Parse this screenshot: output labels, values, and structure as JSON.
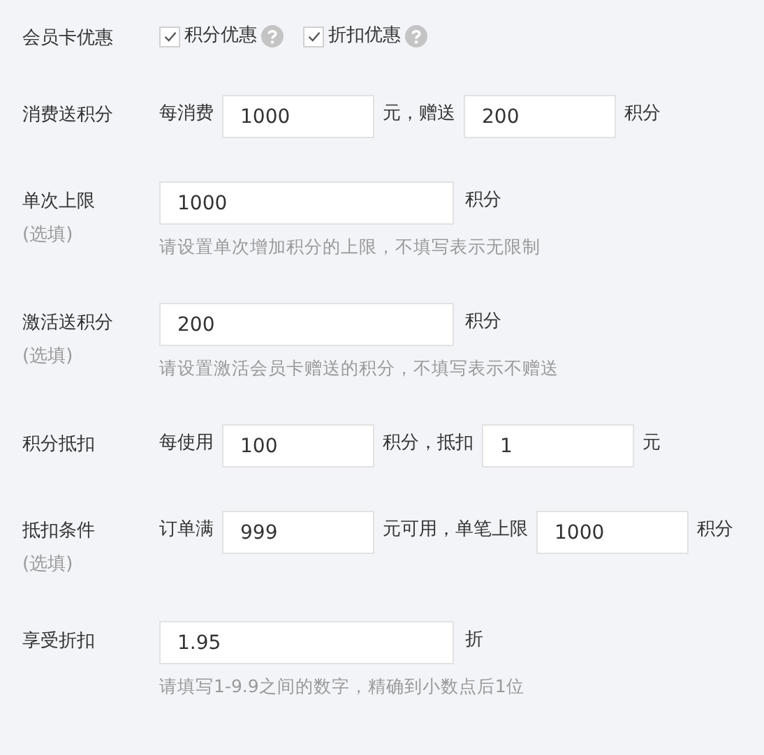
{
  "rows": [
    {
      "label": "会员卡优惠",
      "parts": [
        {
          "kind": "checkbox",
          "label": "积分优惠",
          "checked": true
        },
        {
          "kind": "checkbox",
          "label": "折扣优惠",
          "checked": true
        }
      ]
    },
    {
      "label": "消费送积分",
      "parts": [
        {
          "kind": "text",
          "text": "每消费"
        },
        {
          "kind": "input",
          "value": "1000"
        },
        {
          "kind": "text",
          "text": "元，赠送"
        },
        {
          "kind": "input",
          "value": "200"
        },
        {
          "kind": "text",
          "text": "积分"
        }
      ]
    },
    {
      "label": "单次上限",
      "optional": "(选填)",
      "parts": [
        {
          "kind": "wideinput",
          "value": "1000"
        },
        {
          "kind": "text",
          "text": "积分"
        }
      ],
      "hint": "请设置单次增加积分的上限，不填写表示无限制"
    },
    {
      "label": "激活送积分",
      "optional": "(选填)",
      "parts": [
        {
          "kind": "wideinput",
          "value": "200"
        },
        {
          "kind": "text",
          "text": "积分"
        }
      ],
      "hint": "请设置激活会员卡赠送的积分，不填写表示不赠送"
    },
    {
      "label": "积分抵扣",
      "parts": [
        {
          "kind": "text",
          "text": "每使用"
        },
        {
          "kind": "input",
          "value": "100"
        },
        {
          "kind": "text",
          "text": "积分，抵扣"
        },
        {
          "kind": "input",
          "value": "1"
        },
        {
          "kind": "text",
          "text": "元"
        }
      ]
    },
    {
      "label": "抵扣条件",
      "optional": "(选填)",
      "parts": [
        {
          "kind": "text",
          "text": "订单满"
        },
        {
          "kind": "input",
          "value": "999"
        },
        {
          "kind": "text",
          "text": "元可用，单笔上限"
        },
        {
          "kind": "input",
          "value": "1000"
        },
        {
          "kind": "text",
          "text": "积分"
        }
      ]
    },
    {
      "label": "享受折扣",
      "parts": [
        {
          "kind": "wideinput",
          "value": "1.95"
        },
        {
          "kind": "text",
          "text": "折"
        }
      ],
      "hint": "请填写1-9.9之间的数字，精确到小数点后1位"
    }
  ]
}
